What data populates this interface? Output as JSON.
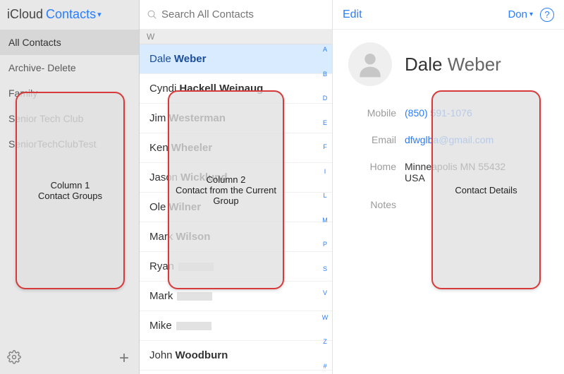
{
  "header": {
    "brand": "iCloud",
    "app": "Contacts"
  },
  "sidebar": {
    "groups": [
      {
        "label": "All Contacts",
        "selected": true
      },
      {
        "label": "Archive- Delete",
        "selected": false
      },
      {
        "label": "Family",
        "selected": false
      },
      {
        "label": "Senior Tech Club",
        "selected": false
      },
      {
        "label": "SeniorTechClubTest",
        "selected": false
      }
    ]
  },
  "search": {
    "placeholder": "Search All Contacts"
  },
  "list": {
    "section": "W",
    "contacts": [
      {
        "first": "Dale",
        "last": "Weber",
        "selected": true
      },
      {
        "first": "Cyndi",
        "last": "Hackell Weinaug"
      },
      {
        "first": "Jim",
        "last": "Westerman"
      },
      {
        "first": "Ken",
        "last": "Wheeler"
      },
      {
        "first": "Jason",
        "last": "Wicklund"
      },
      {
        "first": "Ole",
        "last": "Wilner"
      },
      {
        "first": "Mark",
        "last": "Wilson"
      },
      {
        "first": "Ryan",
        "last": "",
        "redacted": true
      },
      {
        "first": "Mark",
        "last": "",
        "redacted": true
      },
      {
        "first": "Mike",
        "last": "",
        "redacted": true
      },
      {
        "first": "John",
        "last": "Woodburn"
      }
    ],
    "index": [
      "A",
      "B",
      "D",
      "E",
      "F",
      "I",
      "L",
      "M",
      "P",
      "S",
      "V",
      "W",
      "Z",
      "#"
    ]
  },
  "details": {
    "edit": "Edit",
    "user": "Don",
    "name_first": "Dale",
    "name_last": "Weber",
    "fields": [
      {
        "label": "Mobile",
        "value": "(850) 591-1076",
        "link": true
      },
      {
        "label": "Email",
        "value": "dfwglba@gmail.com",
        "link": true
      },
      {
        "label": "Home",
        "value": "Minneapolis MN 55432\nUSA"
      },
      {
        "label": "Notes",
        "value": ""
      }
    ]
  },
  "annotations": {
    "col1": "Column 1\nContact Groups",
    "col2": "Column 2\nContact from the Current Group",
    "col3": "Contact Details"
  }
}
